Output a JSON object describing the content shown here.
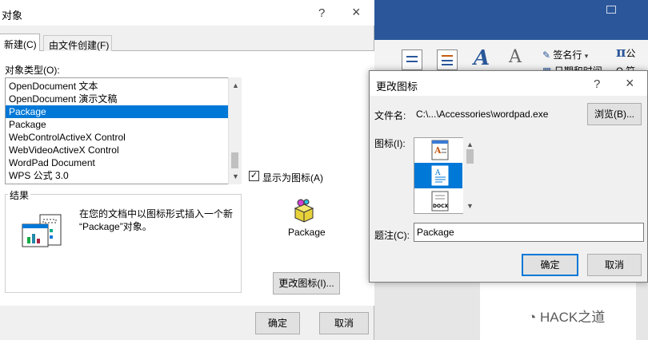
{
  "object_dialog": {
    "title": "对象",
    "help_glyph": "?",
    "close_glyph": "×",
    "tabs": [
      "新建(C)",
      "由文件创建(F)"
    ],
    "object_type_label": "对象类型(O):",
    "object_types": [
      "OpenDocument 文本",
      "OpenDocument 演示文稿",
      "Package",
      "Package",
      "WebControlActiveX Control",
      "WebVideoActiveX Control",
      "WordPad Document",
      "WPS 公式 3.0"
    ],
    "selected_index": 2,
    "display_as_icon_checked": "✓",
    "display_as_icon_label": "显示为图标(A)",
    "result_legend": "结果",
    "result_text": "在您的文档中以图标形式插入一个新 “Package”对象。",
    "icon_caption": "Package",
    "change_icon_button": "更改图标(I)...",
    "ok_button": "确定",
    "cancel_button": "取消"
  },
  "change_icon_dialog": {
    "title": "更改图标",
    "help_glyph": "?",
    "close_glyph": "×",
    "filename_label": "文件名:",
    "filename_value": "C:\\...\\Accessories\\wordpad.exe",
    "browse_button": "浏览(B)...",
    "icon_label": "图标(I):",
    "docx_icon_caption": "DOCX",
    "caption_label": "题注(C):",
    "caption_value": "Package",
    "ok_button": "确定",
    "cancel_button": "取消"
  },
  "ribbon": {
    "signature_line": "签名行",
    "signature_dropdown": "▾",
    "date_time": "日期和时间",
    "pi_symbol": "π",
    "formula_prefix": "公",
    "symbol_prefix": "Ω 符"
  },
  "watermark": "HACK之道",
  "colors": {
    "word_blue": "#2b579a",
    "selection_blue": "#0078d7",
    "dialog_gray": "#f0f0f0"
  }
}
